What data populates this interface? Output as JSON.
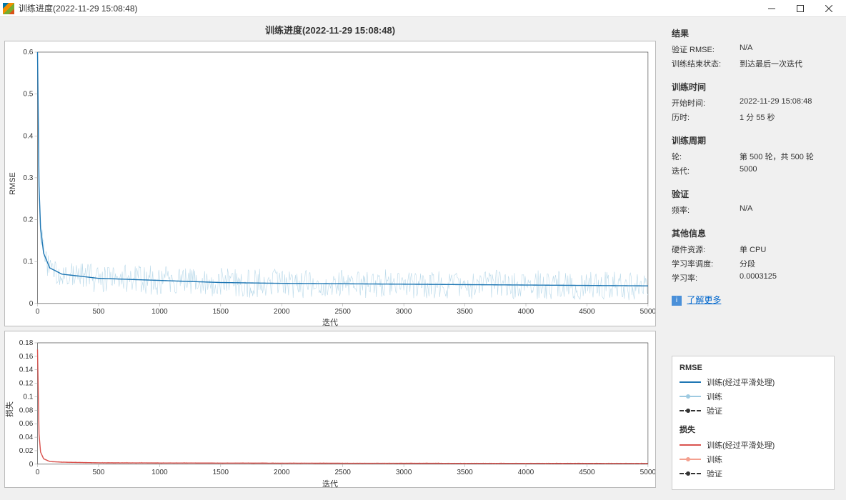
{
  "window": {
    "title": "训练进度(2022-11-29 15:08:48)"
  },
  "plot_title": "训练进度(2022-11-29 15:08:48)",
  "axes": {
    "y1": "RMSE",
    "y2": "损失",
    "x": "迭代"
  },
  "sidebar": {
    "results_h": "结果",
    "val_rmse_k": "验证 RMSE:",
    "val_rmse_v": "N/A",
    "end_state_k": "训练结束状态:",
    "end_state_v": "到达最后一次迭代",
    "time_h": "训练时间",
    "start_k": "开始时间:",
    "start_v": "2022-11-29 15:08:48",
    "elapsed_k": "历时:",
    "elapsed_v": "1 分 55 秒",
    "cycle_h": "训练周期",
    "epoch_k": "轮:",
    "epoch_v": "第 500 轮，共 500 轮",
    "iter_k": "迭代:",
    "iter_v": "5000",
    "val_h": "验证",
    "freq_k": "频率:",
    "freq_v": "N/A",
    "other_h": "其他信息",
    "hw_k": "硬件资源:",
    "hw_v": "单 CPU",
    "sched_k": "学习率调度:",
    "sched_v": "分段",
    "lr_k": "学习率:",
    "lr_v": "0.0003125",
    "learn_more": "了解更多"
  },
  "legend": {
    "rmse": "RMSE",
    "loss": "损失",
    "train_smooth": "训练(经过平滑处理)",
    "train": "训练",
    "val": "验证"
  },
  "chart_data": [
    {
      "type": "line",
      "title": "RMSE",
      "xlabel": "迭代",
      "ylabel": "RMSE",
      "xlim": [
        0,
        5000
      ],
      "ylim": [
        0,
        0.6
      ],
      "x_ticks": [
        0,
        500,
        1000,
        1500,
        2000,
        2500,
        3000,
        3500,
        4000,
        4500,
        5000
      ],
      "y_ticks": [
        0,
        0.1,
        0.2,
        0.3,
        0.4,
        0.5,
        0.6
      ],
      "series": [
        {
          "name": "训练(经过平滑处理)",
          "color": "#1f77b4",
          "x": [
            0,
            10,
            25,
            50,
            100,
            200,
            500,
            1000,
            1500,
            2000,
            2500,
            3000,
            3500,
            4000,
            4500,
            5000
          ],
          "y": [
            0.6,
            0.3,
            0.18,
            0.12,
            0.085,
            0.07,
            0.06,
            0.055,
            0.05,
            0.048,
            0.047,
            0.046,
            0.045,
            0.044,
            0.043,
            0.042
          ]
        },
        {
          "name": "训练",
          "color": "#9ecae1",
          "noise": 0.035
        }
      ]
    },
    {
      "type": "line",
      "title": "损失",
      "xlabel": "迭代",
      "ylabel": "损失",
      "xlim": [
        0,
        5000
      ],
      "ylim": [
        0,
        0.18
      ],
      "x_ticks": [
        0,
        500,
        1000,
        1500,
        2000,
        2500,
        3000,
        3500,
        4000,
        4500,
        5000
      ],
      "y_ticks": [
        0,
        0.02,
        0.04,
        0.06,
        0.08,
        0.1,
        0.12,
        0.14,
        0.16,
        0.18
      ],
      "series": [
        {
          "name": "训练(经过平滑处理)",
          "color": "#d9534f",
          "x": [
            0,
            10,
            25,
            50,
            100,
            200,
            500,
            1000,
            2000,
            3000,
            4000,
            5000
          ],
          "y": [
            0.17,
            0.05,
            0.018,
            0.008,
            0.004,
            0.003,
            0.002,
            0.0018,
            0.0015,
            0.0013,
            0.0012,
            0.0011
          ]
        },
        {
          "name": "训练",
          "color": "#f4a08f",
          "noise": 0.001
        }
      ]
    }
  ]
}
